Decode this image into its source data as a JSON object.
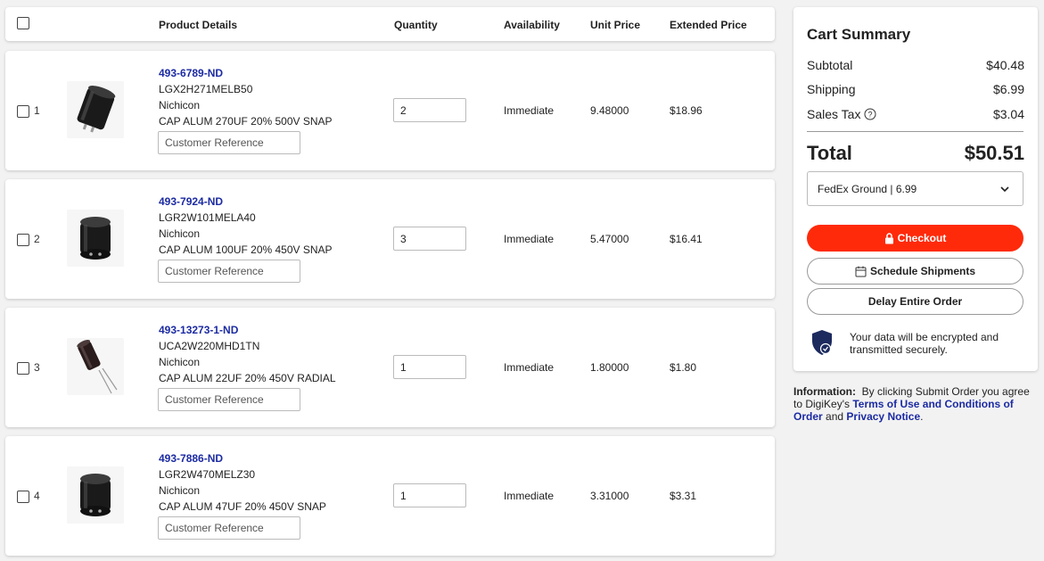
{
  "header": {
    "product_details": "Product Details",
    "quantity": "Quantity",
    "availability": "Availability",
    "unit_price": "Unit Price",
    "extended_price": "Extended Price"
  },
  "items": [
    {
      "index": "1",
      "part_number": "493-6789-ND",
      "mfr_part": "LGX2H271MELB50",
      "manufacturer": "Nichicon",
      "description": "CAP ALUM 270UF 20% 500V SNAP",
      "customer_ref_placeholder": "Customer Reference",
      "quantity": "2",
      "availability": "Immediate",
      "unit_price": "9.48000",
      "extended_price": "$18.96",
      "image_icon": "snap-in-capacitor"
    },
    {
      "index": "2",
      "part_number": "493-7924-ND",
      "mfr_part": "LGR2W101MELA40",
      "manufacturer": "Nichicon",
      "description": "CAP ALUM 100UF 20% 450V SNAP",
      "customer_ref_placeholder": "Customer Reference",
      "quantity": "3",
      "availability": "Immediate",
      "unit_price": "5.47000",
      "extended_price": "$16.41",
      "image_icon": "snap-in-capacitor"
    },
    {
      "index": "3",
      "part_number": "493-13273-1-ND",
      "mfr_part": "UCA2W220MHD1TN",
      "manufacturer": "Nichicon",
      "description": "CAP ALUM 22UF 20% 450V RADIAL",
      "customer_ref_placeholder": "Customer Reference",
      "quantity": "1",
      "availability": "Immediate",
      "unit_price": "1.80000",
      "extended_price": "$1.80",
      "image_icon": "radial-capacitor"
    },
    {
      "index": "4",
      "part_number": "493-7886-ND",
      "mfr_part": "LGR2W470MELZ30",
      "manufacturer": "Nichicon",
      "description": "CAP ALUM 47UF 20% 450V SNAP",
      "customer_ref_placeholder": "Customer Reference",
      "quantity": "1",
      "availability": "Immediate",
      "unit_price": "3.31000",
      "extended_price": "$3.31",
      "image_icon": "snap-in-capacitor"
    }
  ],
  "summary": {
    "title": "Cart Summary",
    "subtotal_label": "Subtotal",
    "subtotal_value": "$40.48",
    "shipping_label": "Shipping",
    "shipping_value": "$6.99",
    "tax_label": "Sales Tax",
    "tax_value": "$3.04",
    "total_label": "Total",
    "total_value": "$50.51",
    "shipping_method": "FedEx Ground | 6.99",
    "checkout_label": "Checkout",
    "schedule_label": "Schedule Shipments",
    "delay_label": "Delay Entire Order",
    "secure_text": "Your data will be encrypted and transmitted securely."
  },
  "info": {
    "label": "Information:",
    "text_1": "By clicking Submit Order you agree to DigiKey's",
    "terms_link": "Terms of Use and Conditions of Order",
    "text_2": "and",
    "privacy_link": "Privacy Notice",
    "text_3": "."
  },
  "colors": {
    "accent_red": "#ff2a0a",
    "link_blue": "#1c2ba3",
    "shield_navy": "#1c2a5e"
  }
}
